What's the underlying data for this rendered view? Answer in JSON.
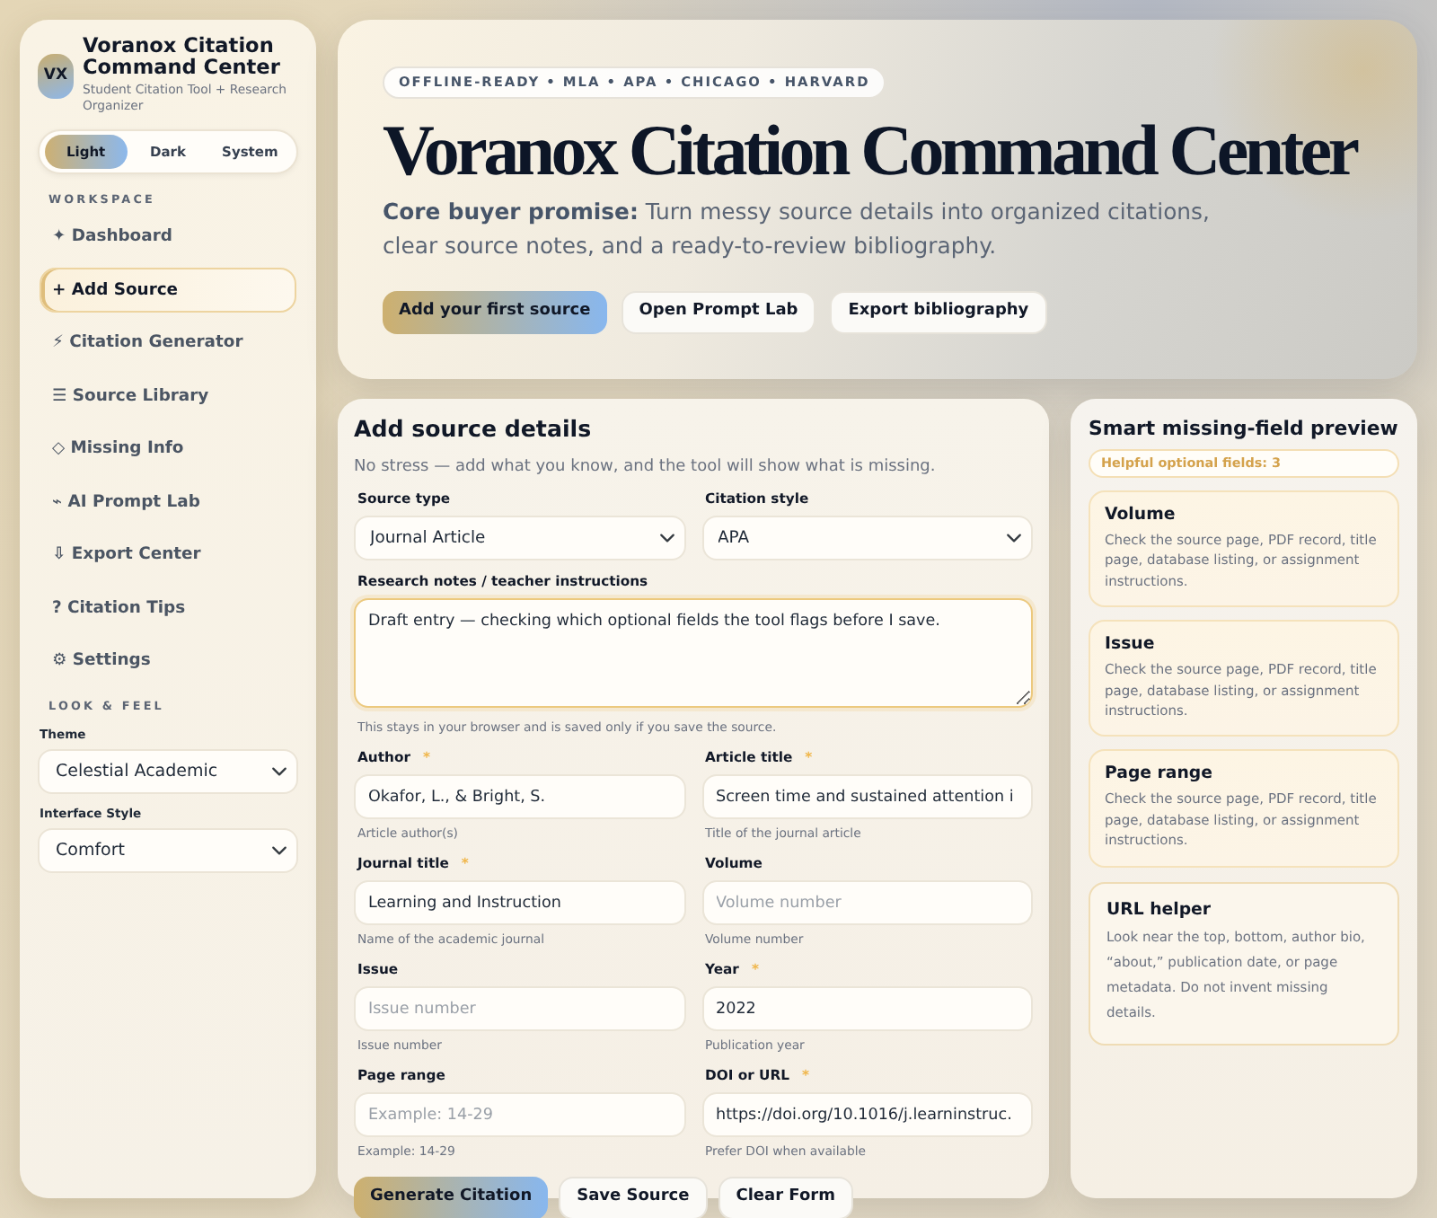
{
  "sidebar": {
    "logo": "VX",
    "title": "Voranox Citation Command Center",
    "subtitle": "Student Citation Tool + Research Organizer",
    "modes": [
      {
        "label": "Light",
        "selected": true
      },
      {
        "label": "Dark",
        "selected": false
      },
      {
        "label": "System",
        "selected": false
      }
    ],
    "nav_heading": "WORKSPACE",
    "nav": [
      {
        "label": "✦ Dashboard",
        "selected": false
      },
      {
        "label": "+ Add Source",
        "selected": true
      },
      {
        "label": "⚡ Citation Generator",
        "selected": false
      },
      {
        "label": "☰ Source Library",
        "selected": false
      },
      {
        "label": "◇ Missing Info",
        "selected": false
      },
      {
        "label": "⌁ AI Prompt Lab",
        "selected": false
      },
      {
        "label": "⇩ Export Center",
        "selected": false
      },
      {
        "label": "? Citation Tips",
        "selected": false
      },
      {
        "label": "⚙ Settings",
        "selected": false
      }
    ],
    "settings_heading": "LOOK & FEEL",
    "settings": [
      {
        "label": "Theme",
        "value": "Celestial Academic"
      },
      {
        "label": "Interface Style",
        "value": "Comfort"
      }
    ]
  },
  "hero": {
    "tag": "OFFLINE-READY • MLA • APA • CHICAGO • HARVARD",
    "title": "Voranox Citation Command Center",
    "promise": "**Core buyer promise:** Turn messy source details into organized citations, clear source notes, and a ready-to-review bibliography.",
    "buttons": [
      {
        "label": "Add your first source",
        "kind": "primary"
      },
      {
        "label": "Open Prompt Lab",
        "kind": "secondary"
      },
      {
        "label": "Export bibliography",
        "kind": "secondary"
      }
    ]
  },
  "form": {
    "title": "Add source details",
    "subtitle": "No stress — add what you know, and the tool will show what is missing.",
    "rows": [
      [
        {
          "kind": "select",
          "label": "Source type",
          "value": "Journal Article",
          "focused": false
        },
        {
          "kind": "select",
          "label": "Citation style",
          "value": "APA",
          "focused": false
        }
      ],
      [
        {
          "kind": "textarea",
          "label": "Research notes / teacher instructions",
          "value": "Draft entry — checking which optional fields the tool flags before I save.",
          "focused": true,
          "help": "This stays in your browser and is saved only if you save the source."
        }
      ],
      [
        {
          "kind": "input",
          "label": "Author",
          "required_mark": "*",
          "value": "Okafor, L., & Bright, S.",
          "focused": false,
          "help": "Article author(s)"
        },
        {
          "kind": "input",
          "label": "Article title",
          "required_mark": "*",
          "value": "Screen time and sustained attention i",
          "focused": false,
          "help": "Title of the journal article"
        }
      ],
      [
        {
          "kind": "input",
          "label": "Journal title",
          "required_mark": "*",
          "value": "Learning and Instruction",
          "focused": false,
          "help": "Name of the academic journal"
        },
        {
          "kind": "input",
          "label": "Volume",
          "placeholder": "Volume number",
          "focused": false,
          "help": "Volume number"
        }
      ],
      [
        {
          "kind": "input",
          "label": "Issue",
          "placeholder": "Issue number",
          "focused": false,
          "help": "Issue number"
        },
        {
          "kind": "input",
          "label": "Year",
          "required_mark": "*",
          "value": "2022",
          "focused": false,
          "help": "Publication year"
        }
      ],
      [
        {
          "kind": "input",
          "label": "Page range",
          "placeholder": "Example: 14-29",
          "focused": false,
          "help": "Example: 14-29"
        },
        {
          "kind": "input",
          "label": "DOI or URL",
          "required_mark": "*",
          "value": "https://doi.org/10.1016/j.learninstruc.",
          "focused": false,
          "help": "Prefer DOI when available"
        }
      ]
    ],
    "buttons": [
      {
        "label": "Generate Citation",
        "kind": "primary"
      },
      {
        "label": "Save Source",
        "kind": "secondary"
      },
      {
        "label": "Clear Form",
        "kind": "secondary"
      }
    ]
  },
  "preview": {
    "title": "Smart missing-field preview",
    "count": "Helpful optional fields: 3",
    "cards": [
      {
        "kind": "missing",
        "title": "Volume",
        "text": "Check the source page, PDF record, title page, database listing, or assignment instructions."
      },
      {
        "kind": "missing",
        "title": "Issue",
        "text": "Check the source page, PDF record, title page, database listing, or assignment instructions."
      },
      {
        "kind": "missing",
        "title": "Page range",
        "text": "Check the source page, PDF record, title page, database listing, or assignment instructions."
      },
      {
        "kind": "helper",
        "title": "URL helper",
        "text": "Look near the top, bottom, author bio, “about,” publication date, or page metadata. Do not invent missing details."
      }
    ]
  }
}
